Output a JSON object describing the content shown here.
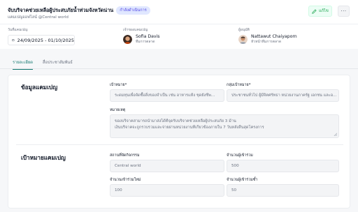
{
  "header": {
    "title": "จับบริจาคช่วยเหลือผู้ประสบภัยน้ำท่วมจังหวัดน่าน",
    "status": "กำลังดำเนินการ",
    "subtitle": "แคมเปญออฟไลน์ @Central world",
    "edit_label": "แก้ไข",
    "more_label": "···"
  },
  "info": {
    "date_label": "วันที่แคมเปญ",
    "date_range": "24/09/2025 - 01/10/2025",
    "owner_label": "เจ้าของแคมเปญ",
    "owner_name": "Sofia Davis",
    "owner_role": "ทีมการตลาด",
    "approver_label": "ผู้อนุมัติ",
    "approver_name": "Nattawut Chaiyaporn",
    "approver_role": "หัวหน้าทีมการตลาด"
  },
  "tabs": [
    {
      "label": "รายละเอียด",
      "active": true
    },
    {
      "label": "สื่อประชาสัมพันธ์",
      "active": false
    }
  ],
  "campaign_info": {
    "section_title": "ข้อมูลแคมเปญ",
    "objective_label": "เป้าหมาย*",
    "objective_value": "ระดมทุนเพื่อจัดซื้อสิ่งของจำเป็น เช่น อาหารแห้ง ชุดยังชีพ...",
    "target_group_label": "กลุ่มเป้าหมาย*",
    "target_group_value": "ประชาชนทั่วไป ผู้มีจิตศรัทธา หน่วยงานภาครัฐ เอกชน และอ...",
    "notes_label": "หมายเหตุ",
    "notes_line1": "ของบริจาคสามารถนำมาส่งได้ที่จุดรับบริจาคช่วยเหลือผู้ประสบภัย 3 ม้าน",
    "notes_line2": "เงินบริจาคจะถูกรวบรวมและจ่ายผ่านหน่วยงานที่เกี่ยวข้องภายใน 7 วันหลังสิ้นสุดโครงการ"
  },
  "campaign_targets": {
    "section_title": "เป้าหมายแคมเปญ",
    "venue_label": "สถานที่จัดกิจกรรม",
    "venue_value": "Central world",
    "participants_label": "จำนวนผู้เข้าร่วม",
    "participants_value": "500",
    "new_members_label": "จำนวนเข้าร่วมใหม่",
    "new_members_value": "100",
    "repeat_label": "จำนวนผู้เข้าร่วมซ้ำ",
    "repeat_value": "50"
  },
  "colors": {
    "accent": "#0f766e",
    "status_badge_bg": "#e0e7ff",
    "status_badge_text": "#4f46e5",
    "edit_button": "#16a34a"
  }
}
